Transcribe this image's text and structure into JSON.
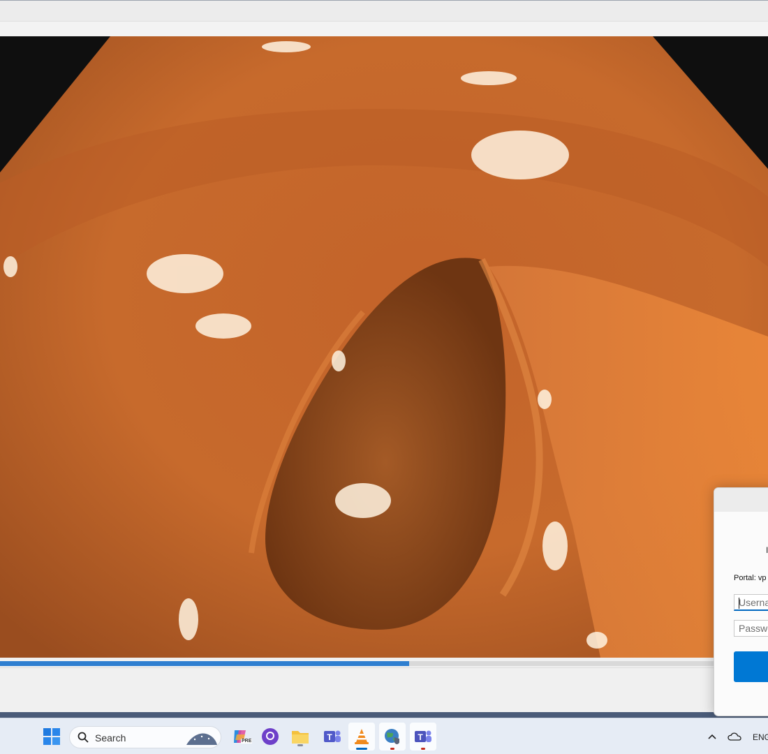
{
  "video": {
    "progress_fraction": 0.533
  },
  "dialog": {
    "heading_partial": "I",
    "portal_label": "Portal: vp",
    "username_placeholder": "Userna",
    "password_placeholder": "Passwo"
  },
  "taskbar": {
    "search_label": "Search",
    "copilot_badge": "PRE",
    "language": "ENG",
    "icons": [
      "windows-start-icon",
      "search-icon",
      "copilot-icon",
      "github-desktop-icon",
      "file-explorer-icon",
      "teams-icon",
      "vlc-icon",
      "globe-vpn-icon",
      "teams-alt-icon",
      "chevron-up-icon",
      "onedrive-icon"
    ]
  },
  "colors": {
    "accent": "#0078d4",
    "progress": "#2f7fd0",
    "taskbar": "#e6ecf5"
  }
}
